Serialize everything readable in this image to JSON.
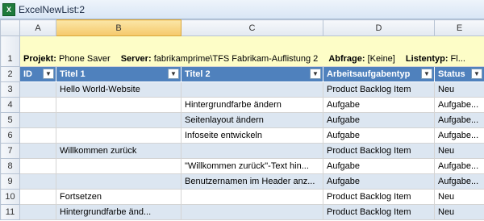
{
  "window": {
    "title": "ExcelNewList:2",
    "icon": "excel-icon"
  },
  "columns": [
    "A",
    "B",
    "C",
    "D",
    "E"
  ],
  "info": {
    "projekt_label": "Projekt:",
    "projekt_value": "Phone Saver",
    "server_label": "Server:",
    "server_value": "fabrikamprime\\TFS Fabrikam-Auflistung 2",
    "abfrage_label": "Abfrage:",
    "abfrage_value": "[Keine]",
    "listentyp_label": "Listentyp:",
    "listentyp_value": "Fl..."
  },
  "header": [
    "ID",
    "Titel 1",
    "Titel 2",
    "Arbeitsaufgabentyp",
    "Status"
  ],
  "rows": [
    {
      "num": "1"
    },
    {
      "num": "2"
    },
    {
      "num": "3",
      "cells": [
        "",
        "Hello World-Website",
        "",
        "Product Backlog Item",
        "Neu"
      ]
    },
    {
      "num": "4",
      "cells": [
        "",
        "",
        "Hintergrundfarbe ändern",
        "Aufgabe",
        "Aufgabe..."
      ]
    },
    {
      "num": "5",
      "cells": [
        "",
        "",
        "Seitenlayout ändern",
        "Aufgabe",
        "Aufgabe..."
      ]
    },
    {
      "num": "6",
      "cells": [
        "",
        "",
        "Infoseite entwickeln",
        "Aufgabe",
        "Aufgabe..."
      ]
    },
    {
      "num": "7",
      "cells": [
        "",
        "Willkommen zurück",
        "",
        "Product Backlog Item",
        "Neu"
      ]
    },
    {
      "num": "8",
      "cells": [
        "",
        "",
        "\"Willkommen zurück\"-Text hin...",
        "Aufgabe",
        "Aufgabe..."
      ]
    },
    {
      "num": "9",
      "cells": [
        "",
        "",
        "Benutzernamen im Header anz...",
        "Aufgabe",
        "Aufgabe..."
      ]
    },
    {
      "num": "10",
      "cells": [
        "",
        "Fortsetzen",
        "",
        "Product Backlog Item",
        "Neu"
      ]
    },
    {
      "num": "11",
      "cells": [
        "",
        "Hintergrundfarbe änd...",
        "",
        "Product Backlog Item",
        "Neu"
      ]
    }
  ]
}
